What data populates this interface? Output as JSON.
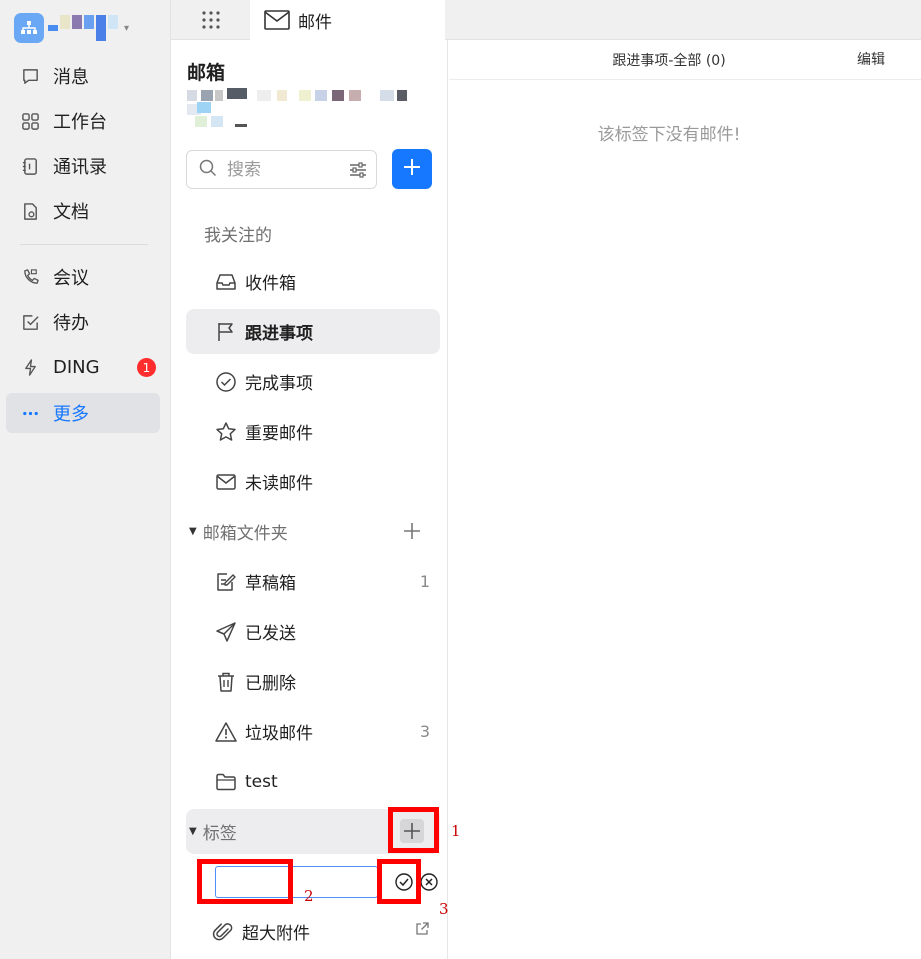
{
  "rail": {
    "org_caret": "▾",
    "items": [
      {
        "label": "消息",
        "icon": "chat-bubble-icon"
      },
      {
        "label": "工作台",
        "icon": "grid-apps-icon"
      },
      {
        "label": "通讯录",
        "icon": "contacts-book-icon"
      },
      {
        "label": "文档",
        "icon": "document-icon"
      },
      {
        "label": "会议",
        "icon": "video-call-icon"
      },
      {
        "label": "待办",
        "icon": "checkbox-icon"
      },
      {
        "label": "DING",
        "icon": "lightning-icon",
        "badge": "1"
      },
      {
        "label": "更多",
        "icon": "more-dots-icon",
        "active": true
      }
    ]
  },
  "topbar": {
    "tab_label": "邮件"
  },
  "panel": {
    "title": "邮箱",
    "search_placeholder": "搜索",
    "section_following": "我关注的",
    "following_items": [
      {
        "label": "收件箱",
        "icon": "inbox-tray-icon"
      },
      {
        "label": "跟进事项",
        "icon": "flag-icon",
        "selected": true
      },
      {
        "label": "完成事项",
        "icon": "check-circle-icon"
      },
      {
        "label": "重要邮件",
        "icon": "star-icon"
      },
      {
        "label": "未读邮件",
        "icon": "envelope-icon"
      }
    ],
    "folders_header": "邮箱文件夹",
    "folder_items": [
      {
        "label": "草稿箱",
        "icon": "draft-edit-icon",
        "count": "1"
      },
      {
        "label": "已发送",
        "icon": "paper-plane-icon",
        "count": ""
      },
      {
        "label": "已删除",
        "icon": "trash-icon",
        "count": ""
      },
      {
        "label": "垃圾邮件",
        "icon": "warning-triangle-icon",
        "count": "3"
      },
      {
        "label": "test",
        "icon": "folder-icon",
        "count": ""
      }
    ],
    "tags_header": "标签",
    "tag_input_value": "",
    "large_attachment": "超大附件"
  },
  "main": {
    "title": "跟进事项-全部 (0)",
    "edit_label": "编辑",
    "empty_message": "该标签下没有邮件!"
  },
  "annotations": [
    "1",
    "2",
    "3"
  ],
  "colors": {
    "accent": "#1677ff",
    "badge": "#ff2d2d",
    "annotation": "#ff0000",
    "rail_bg": "#f0f0f1"
  }
}
